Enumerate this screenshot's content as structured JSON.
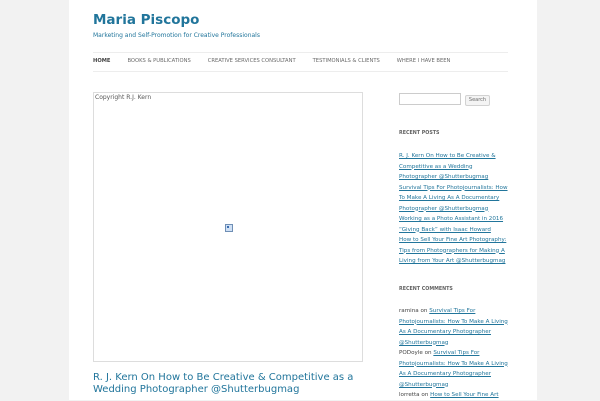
{
  "site": {
    "title": "Maria Piscopo",
    "description": "Marketing and Self-Promotion for Creative Professionals"
  },
  "nav": {
    "items": [
      {
        "label": "HOME",
        "active": true
      },
      {
        "label": "BOOKS & PUBLICATIONS",
        "active": false
      },
      {
        "label": "CREATIVE SERVICES CONSULTANT",
        "active": false
      },
      {
        "label": "TESTIMONIALS & CLIENTS",
        "active": false
      },
      {
        "label": "WHERE I HAVE BEEN",
        "active": false
      }
    ]
  },
  "post": {
    "image_caption": "Copyright R.J. Kern",
    "title": "R. J. Kern On How to Be Creative & Competitive as a Wedding Photographer @Shutterbugmag"
  },
  "sidebar": {
    "search": {
      "value": "",
      "button_label": "Search"
    },
    "recent_posts": {
      "title": "RECENT POSTS",
      "items": [
        "R. J. Kern On How to Be Creative & Competitive as a Wedding Photographer @Shutterbugmag",
        "Survival Tips For Photojournalists: How To Make A Living As A Documentary Photographer @Shutterbugmag",
        "Working as a Photo Assistant in 2016",
        "“Giving Back” with Isaac Howard",
        "How to Sell Your Fine Art Photography: Tips from Photographers for Making A Living from Your Art @Shutterbugmag"
      ]
    },
    "recent_comments": {
      "title": "RECENT COMMENTS",
      "items": [
        {
          "author": "ramina",
          "on": "on",
          "post": "Survival Tips For Photojournalists: How To Make A Living As A Documentary Photographer @Shutterbugmag"
        },
        {
          "author": "PODoyle",
          "on": "on",
          "post": "Survival Tips For Photojournalists: How To Make A Living As A Documentary Photographer @Shutterbugmag"
        },
        {
          "author": "lorretta",
          "on": "on",
          "post": "How to Sell Your Fine Art"
        }
      ]
    }
  },
  "colors": {
    "link": "#21759b",
    "text": "#444444",
    "background": "#f2f2f2"
  }
}
